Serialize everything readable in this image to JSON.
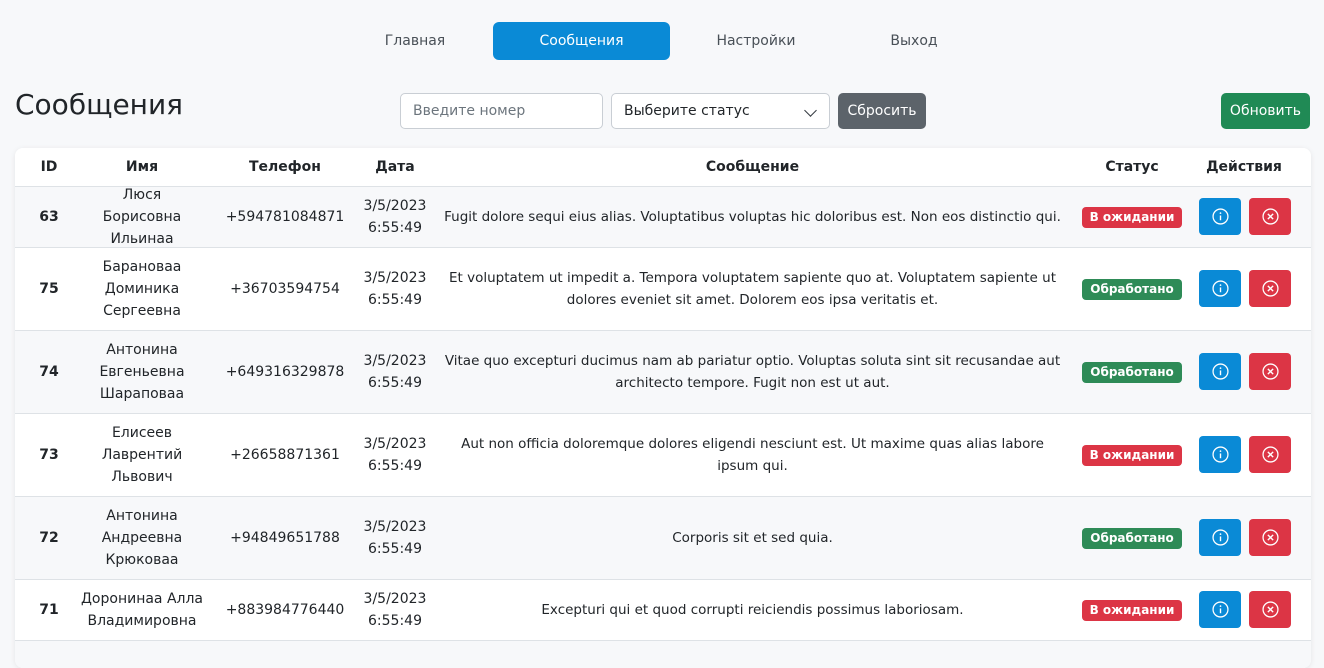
{
  "nav": {
    "items": [
      {
        "label": "Главная",
        "active": false
      },
      {
        "label": "Сообщения",
        "active": true
      },
      {
        "label": "Настройки",
        "active": false
      },
      {
        "label": "Выход",
        "active": false
      }
    ]
  },
  "page": {
    "title": "Сообщения"
  },
  "filters": {
    "search_placeholder": "Введите номер",
    "status_selected": "Выберите статус",
    "reset_label": "Сбросить",
    "refresh_label": "Обновить"
  },
  "table": {
    "columns": [
      "ID",
      "Имя",
      "Телефон",
      "Дата",
      "Сообщение",
      "Статус",
      "Действия"
    ],
    "rows": [
      {
        "id": "63",
        "name": "Люся Борисовна Ильинаа",
        "phone": "+594781084871",
        "date": "3/5/2023 6:55:49",
        "message": "Fugit dolore sequi eius alias. Voluptatibus voluptas hic doloribus est. Non eos distinctio qui.",
        "status": "В ожидании",
        "status_type": "pending"
      },
      {
        "id": "75",
        "name": "Барановаа Доминика Сергеевна",
        "phone": "+36703594754",
        "date": "3/5/2023 6:55:49",
        "message": "Et voluptatem ut impedit a. Tempora voluptatem sapiente quo at. Voluptatem sapiente ut dolores eveniet sit amet. Dolorem eos ipsa veritatis et.",
        "status": "Обработано",
        "status_type": "done"
      },
      {
        "id": "74",
        "name": "Антонина Евгеньевна Шараповаа",
        "phone": "+649316329878",
        "date": "3/5/2023 6:55:49",
        "message": "Vitae quo excepturi ducimus nam ab pariatur optio. Voluptas soluta sint sit recusandae aut architecto tempore. Fugit non est ut aut.",
        "status": "Обработано",
        "status_type": "done"
      },
      {
        "id": "73",
        "name": "Елисеев Лаврентий Львович",
        "phone": "+26658871361",
        "date": "3/5/2023 6:55:49",
        "message": "Aut non officia doloremque dolores eligendi nesciunt est. Ut maxime quas alias labore ipsum qui.",
        "status": "В ожидании",
        "status_type": "pending"
      },
      {
        "id": "72",
        "name": "Антонина Андреевна Крюковаа",
        "phone": "+94849651788",
        "date": "3/5/2023 6:55:49",
        "message": "Corporis sit et sed quia.",
        "status": "Обработано",
        "status_type": "done"
      },
      {
        "id": "71",
        "name": "Доронинаа Алла Владимировна",
        "phone": "+883984776440",
        "date": "3/5/2023 6:55:49",
        "message": "Excepturi qui et quod corrupti reiciendis possimus laboriosam.",
        "status": "В ожидании",
        "status_type": "pending"
      }
    ]
  },
  "colors": {
    "primary": "#0a8ad6",
    "danger": "#dc3545",
    "success": "#2e8b57",
    "secondary": "#5c636a",
    "refresh": "#208a55"
  },
  "icons": {
    "info": "info-circle-icon",
    "delete": "x-circle-icon",
    "select": "chevron-down-icon"
  }
}
